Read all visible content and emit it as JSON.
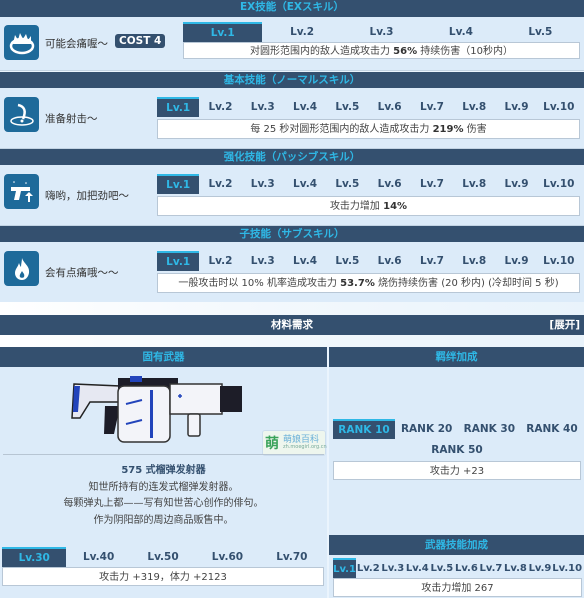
{
  "skills": [
    {
      "section_title": "EX技能（EXスキル）",
      "icon": "flame-ring-icon",
      "name": "可能会痛喔～",
      "cost": "COST 4",
      "levels": [
        "Lv.1",
        "Lv.2",
        "Lv.3",
        "Lv.4",
        "Lv.5"
      ],
      "active_level": "Lv.1",
      "desc_pre": "对圆形范围内的敌人造成攻击力 ",
      "desc_bold": "56%",
      "desc_post": " 持续伤害（10秒内）"
    },
    {
      "section_title": "基本技能（ノーマルスキル）",
      "icon": "arc-shot-target-icon",
      "name": "准备射击～",
      "levels": [
        "Lv.1",
        "Lv.2",
        "Lv.3",
        "Lv.4",
        "Lv.5",
        "Lv.6",
        "Lv.7",
        "Lv.8",
        "Lv.9",
        "Lv.10"
      ],
      "active_level": "Lv.1",
      "desc_pre": "每 25 秒对圆形范围内的敌人造成攻击力 ",
      "desc_bold": "219%",
      "desc_post": " 伤害"
    },
    {
      "section_title": "强化技能（パッシブスキル）",
      "icon": "pistol-upgrade-icon",
      "name": "嗨哟，加把劲吧～",
      "levels": [
        "Lv.1",
        "Lv.2",
        "Lv.3",
        "Lv.4",
        "Lv.5",
        "Lv.6",
        "Lv.7",
        "Lv.8",
        "Lv.9",
        "Lv.10"
      ],
      "active_level": "Lv.1",
      "desc_pre": "攻击力增加 ",
      "desc_bold": "14%",
      "desc_post": ""
    },
    {
      "section_title": "子技能（サブスキル）",
      "icon": "flame-icon",
      "name": "会有点痛哦～～",
      "levels": [
        "Lv.1",
        "Lv.2",
        "Lv.3",
        "Lv.4",
        "Lv.5",
        "Lv.6",
        "Lv.7",
        "Lv.8",
        "Lv.9",
        "Lv.10"
      ],
      "active_level": "Lv.1",
      "desc_pre": "一般攻击时以 10% 机率造成攻击力 ",
      "desc_bold": "53.7%",
      "desc_post": " 烧伤持续伤害 (20 秒内) (冷却时间 5 秒)"
    }
  ],
  "materials": {
    "title": "材料需求",
    "expand_label": "[展开]"
  },
  "weapon": {
    "section_title": "固有武器",
    "name": "575 式榴弹发射器",
    "desc_lines": [
      "知世所持有的连发式榴弹发射器。",
      "每颗弹丸上都——写有知世苦心创作的俳句。",
      "作为阴阳部的周边商品贩售中。"
    ],
    "watermark_char": "萌",
    "watermark_text": "萌娘百科",
    "watermark_url": "zh.moegirl.org.cn",
    "levels": [
      "Lv.30",
      "Lv.40",
      "Lv.50",
      "Lv.60",
      "Lv.70"
    ],
    "active_level": "Lv.30",
    "stat": "攻击力 +319，体力 +2123"
  },
  "bond": {
    "section_title": "羁绊加成",
    "ranks": [
      "RANK 10",
      "RANK 20",
      "RANK 30",
      "RANK 40",
      "RANK 50"
    ],
    "active_rank": "RANK 10",
    "stat": "攻击力 +23"
  },
  "weapon_skill": {
    "section_title": "武器技能加成",
    "levels": [
      "Lv.1",
      "Lv.2",
      "Lv.3",
      "Lv.4",
      "Lv.5",
      "Lv.6",
      "Lv.7",
      "Lv.8",
      "Lv.9",
      "Lv.10"
    ],
    "active_level": "Lv.1",
    "stat": "攻击力增加 267"
  },
  "colors": {
    "header_bg": "#34506f",
    "accent": "#2fb8e6",
    "panel_bg": "#dcebf9",
    "icon_bg": "#1e6a9a"
  }
}
